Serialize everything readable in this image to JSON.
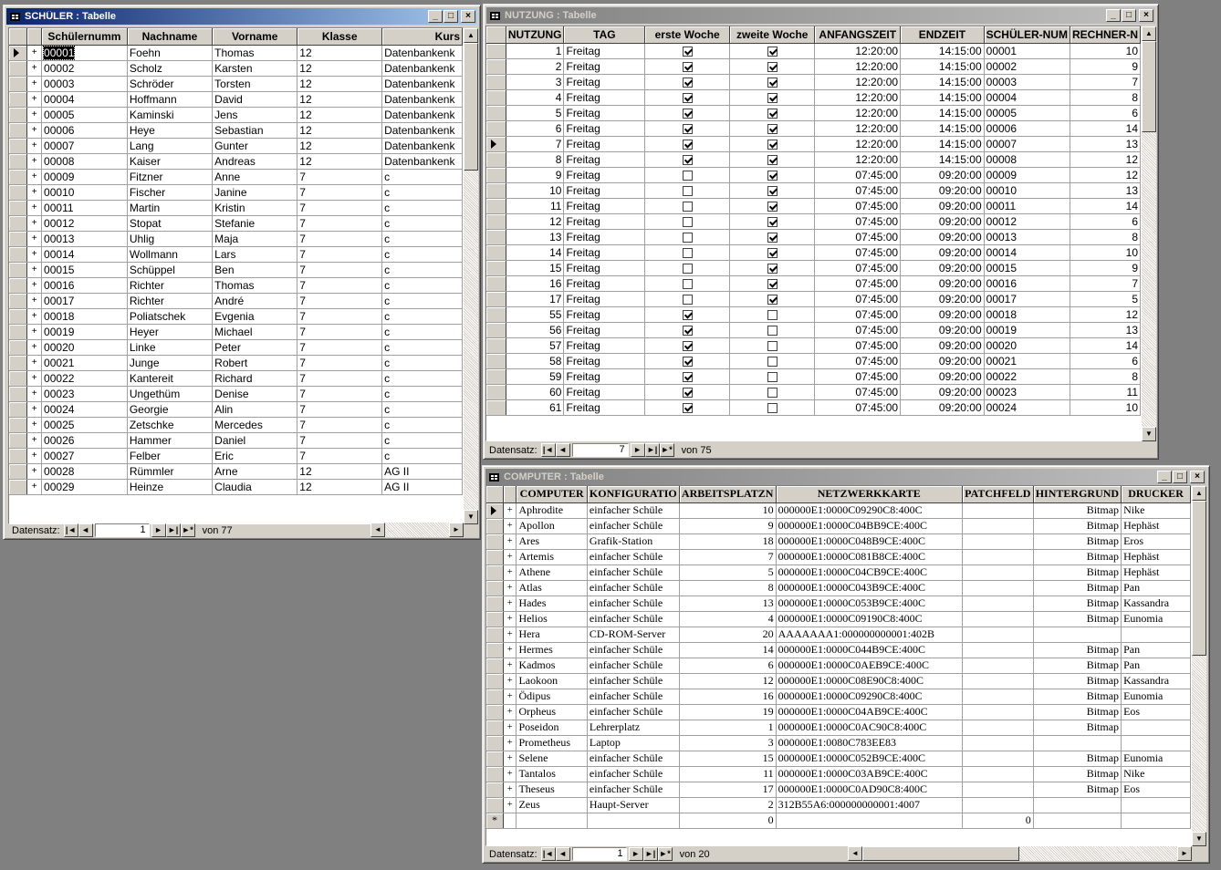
{
  "schueler": {
    "title": "SCHÜLER : Tabelle",
    "columns": [
      "Schülernumm",
      "Nachname",
      "Vorname",
      "Klasse",
      "Kurs"
    ],
    "rows": [
      [
        "00001",
        "Foehn",
        "Thomas",
        "12",
        "Datenbankenk"
      ],
      [
        "00002",
        "Scholz",
        "Karsten",
        "12",
        "Datenbankenk"
      ],
      [
        "00003",
        "Schröder",
        "Torsten",
        "12",
        "Datenbankenk"
      ],
      [
        "00004",
        "Hoffmann",
        "David",
        "12",
        "Datenbankenk"
      ],
      [
        "00005",
        "Kaminski",
        "Jens",
        "12",
        "Datenbankenk"
      ],
      [
        "00006",
        "Heye",
        "Sebastian",
        "12",
        "Datenbankenk"
      ],
      [
        "00007",
        "Lang",
        "Gunter",
        "12",
        "Datenbankenk"
      ],
      [
        "00008",
        "Kaiser",
        "Andreas",
        "12",
        "Datenbankenk"
      ],
      [
        "00009",
        "Fitzner",
        "Anne",
        "7",
        "c"
      ],
      [
        "00010",
        "Fischer",
        "Janine",
        "7",
        "c"
      ],
      [
        "00011",
        "Martin",
        "Kristin",
        "7",
        "c"
      ],
      [
        "00012",
        "Stopat",
        "Stefanie",
        "7",
        "c"
      ],
      [
        "00013",
        "Uhlig",
        "Maja",
        "7",
        "c"
      ],
      [
        "00014",
        "Wollmann",
        "Lars",
        "7",
        "c"
      ],
      [
        "00015",
        "Schüppel",
        "Ben",
        "7",
        "c"
      ],
      [
        "00016",
        "Richter",
        "Thomas",
        "7",
        "c"
      ],
      [
        "00017",
        "Richter",
        "André",
        "7",
        "c"
      ],
      [
        "00018",
        "Poliatschek",
        "Evgenia",
        "7",
        "c"
      ],
      [
        "00019",
        "Heyer",
        "Michael",
        "7",
        "c"
      ],
      [
        "00020",
        "Linke",
        "Peter",
        "7",
        "c"
      ],
      [
        "00021",
        "Junge",
        "Robert",
        "7",
        "c"
      ],
      [
        "00022",
        "Kantereit",
        "Richard",
        "7",
        "c"
      ],
      [
        "00023",
        "Ungethüm",
        "Denise",
        "7",
        "c"
      ],
      [
        "00024",
        "Georgie",
        "Alin",
        "7",
        "c"
      ],
      [
        "00025",
        "Zetschke",
        "Mercedes",
        "7",
        "c"
      ],
      [
        "00026",
        "Hammer",
        "Daniel",
        "7",
        "c"
      ],
      [
        "00027",
        "Felber",
        "Eric",
        "7",
        "c"
      ],
      [
        "00028",
        "Rümmler",
        "Arne",
        "12",
        "AG II"
      ],
      [
        "00029",
        "Heinze",
        "Claudia",
        "12",
        "AG II"
      ]
    ],
    "expand_symbol": "+",
    "nav": {
      "label": "Datensatz:",
      "current": "1",
      "total_label": "von 77"
    }
  },
  "nutzung": {
    "title": "NUTZUNG : Tabelle",
    "columns": [
      "NUTZUNG",
      "TAG",
      "erste Woche",
      "zweite Woche",
      "ANFANGSZEIT",
      "ENDZEIT",
      "SCHÜLER-NUM",
      "RECHNER-N"
    ],
    "rows": [
      [
        "1",
        "Freitag",
        true,
        true,
        "12:20:00",
        "14:15:00",
        "00001",
        "10"
      ],
      [
        "2",
        "Freitag",
        true,
        true,
        "12:20:00",
        "14:15:00",
        "00002",
        "9"
      ],
      [
        "3",
        "Freitag",
        true,
        true,
        "12:20:00",
        "14:15:00",
        "00003",
        "7"
      ],
      [
        "4",
        "Freitag",
        true,
        true,
        "12:20:00",
        "14:15:00",
        "00004",
        "8"
      ],
      [
        "5",
        "Freitag",
        true,
        true,
        "12:20:00",
        "14:15:00",
        "00005",
        "6"
      ],
      [
        "6",
        "Freitag",
        true,
        true,
        "12:20:00",
        "14:15:00",
        "00006",
        "14"
      ],
      [
        "7",
        "Freitag",
        true,
        true,
        "12:20:00",
        "14:15:00",
        "00007",
        "13"
      ],
      [
        "8",
        "Freitag",
        true,
        true,
        "12:20:00",
        "14:15:00",
        "00008",
        "12"
      ],
      [
        "9",
        "Freitag",
        false,
        true,
        "07:45:00",
        "09:20:00",
        "00009",
        "12"
      ],
      [
        "10",
        "Freitag",
        false,
        true,
        "07:45:00",
        "09:20:00",
        "00010",
        "13"
      ],
      [
        "11",
        "Freitag",
        false,
        true,
        "07:45:00",
        "09:20:00",
        "00011",
        "14"
      ],
      [
        "12",
        "Freitag",
        false,
        true,
        "07:45:00",
        "09:20:00",
        "00012",
        "6"
      ],
      [
        "13",
        "Freitag",
        false,
        true,
        "07:45:00",
        "09:20:00",
        "00013",
        "8"
      ],
      [
        "14",
        "Freitag",
        false,
        true,
        "07:45:00",
        "09:20:00",
        "00014",
        "10"
      ],
      [
        "15",
        "Freitag",
        false,
        true,
        "07:45:00",
        "09:20:00",
        "00015",
        "9"
      ],
      [
        "16",
        "Freitag",
        false,
        true,
        "07:45:00",
        "09:20:00",
        "00016",
        "7"
      ],
      [
        "17",
        "Freitag",
        false,
        true,
        "07:45:00",
        "09:20:00",
        "00017",
        "5"
      ],
      [
        "55",
        "Freitag",
        true,
        false,
        "07:45:00",
        "09:20:00",
        "00018",
        "12"
      ],
      [
        "56",
        "Freitag",
        true,
        false,
        "07:45:00",
        "09:20:00",
        "00019",
        "13"
      ],
      [
        "57",
        "Freitag",
        true,
        false,
        "07:45:00",
        "09:20:00",
        "00020",
        "14"
      ],
      [
        "58",
        "Freitag",
        true,
        false,
        "07:45:00",
        "09:20:00",
        "00021",
        "6"
      ],
      [
        "59",
        "Freitag",
        true,
        false,
        "07:45:00",
        "09:20:00",
        "00022",
        "8"
      ],
      [
        "60",
        "Freitag",
        true,
        false,
        "07:45:00",
        "09:20:00",
        "00023",
        "11"
      ],
      [
        "61",
        "Freitag",
        true,
        false,
        "07:45:00",
        "09:20:00",
        "00024",
        "10"
      ]
    ],
    "nav": {
      "label": "Datensatz:",
      "current": "7",
      "total_label": "von 75"
    }
  },
  "computer": {
    "title": "COMPUTER : Tabelle",
    "columns": [
      "COMPUTER",
      "KONFIGURATIO",
      "ARBEITSPLATZN",
      "NETZWERKKARTE",
      "PATCHFELD",
      "HINTERGRUND",
      "DRUCKER"
    ],
    "rows": [
      [
        "Aphrodite",
        "einfacher Schüle",
        "10",
        "000000E1:0000C09290C8:400C",
        "",
        "Bitmap",
        "Nike"
      ],
      [
        "Apollon",
        "einfacher Schüle",
        "9",
        "000000E1:0000C04BB9CE:400C",
        "",
        "Bitmap",
        "Hephäst"
      ],
      [
        "Ares",
        "Grafik-Station",
        "18",
        "000000E1:0000C048B9CE:400C",
        "",
        "Bitmap",
        "Eros"
      ],
      [
        "Artemis",
        "einfacher Schüle",
        "7",
        "000000E1:0000C081B8CE:400C",
        "",
        "Bitmap",
        "Hephäst"
      ],
      [
        "Athene",
        "einfacher Schüle",
        "5",
        "000000E1:0000C04CB9CE:400C",
        "",
        "Bitmap",
        "Hephäst"
      ],
      [
        "Atlas",
        "einfacher Schüle",
        "8",
        "000000E1:0000C043B9CE:400C",
        "",
        "Bitmap",
        "Pan"
      ],
      [
        "Hades",
        "einfacher Schüle",
        "13",
        "000000E1:0000C053B9CE:400C",
        "",
        "Bitmap",
        "Kassandra"
      ],
      [
        "Helios",
        "einfacher Schüle",
        "4",
        "000000E1:0000C09190C8:400C",
        "",
        "Bitmap",
        "Eunomia"
      ],
      [
        "Hera",
        "CD-ROM-Server",
        "20",
        "AAAAAAA1:000000000001:402B",
        "",
        "",
        ""
      ],
      [
        "Hermes",
        "einfacher Schüle",
        "14",
        "000000E1:0000C044B9CE:400C",
        "",
        "Bitmap",
        "Pan"
      ],
      [
        "Kadmos",
        "einfacher Schüle",
        "6",
        "000000E1:0000C0AEB9CE:400C",
        "",
        "Bitmap",
        "Pan"
      ],
      [
        "Laokoon",
        "einfacher Schüle",
        "12",
        "000000E1:0000C08E90C8:400C",
        "",
        "Bitmap",
        "Kassandra"
      ],
      [
        "Ödipus",
        "einfacher Schüle",
        "16",
        "000000E1:0000C09290C8:400C",
        "",
        "Bitmap",
        "Eunomia"
      ],
      [
        "Orpheus",
        "einfacher Schüle",
        "19",
        "000000E1:0000C04AB9CE:400C",
        "",
        "Bitmap",
        "Eos"
      ],
      [
        "Poseidon",
        "Lehrerplatz",
        "1",
        "000000E1:0000C0AC90C8:400C",
        "",
        "Bitmap",
        ""
      ],
      [
        "Prometheus",
        "Laptop",
        "3",
        "000000E1:0080C783EE83",
        "",
        "",
        ""
      ],
      [
        "Selene",
        "einfacher Schüle",
        "15",
        "000000E1:0000C052B9CE:400C",
        "",
        "Bitmap",
        "Eunomia"
      ],
      [
        "Tantalos",
        "einfacher Schüle",
        "11",
        "000000E1:0000C03AB9CE:400C",
        "",
        "Bitmap",
        "Nike"
      ],
      [
        "Theseus",
        "einfacher Schüle",
        "17",
        "000000E1:0000C0AD90C8:400C",
        "",
        "Bitmap",
        "Eos"
      ],
      [
        "Zeus",
        "Haupt-Server",
        "2",
        "312B55A6:000000000001:4007",
        "",
        "",
        ""
      ]
    ],
    "new_row": {
      "symbol": "*",
      "arbeitsplatz": "0",
      "patchfeld": "0"
    },
    "nav": {
      "label": "Datensatz:",
      "current": "1",
      "total_label": "von 20"
    }
  },
  "nav_buttons": {
    "first": "|◄",
    "prev": "◄",
    "next": "►",
    "last": "►|",
    "new": "►*"
  },
  "window_buttons": {
    "minimize": "_",
    "maximize": "□",
    "close": "×"
  },
  "colors": {
    "desktop": "#808080",
    "active_title": "#0a246a",
    "inactive_title": "#808080",
    "face": "#d4d0c8"
  }
}
